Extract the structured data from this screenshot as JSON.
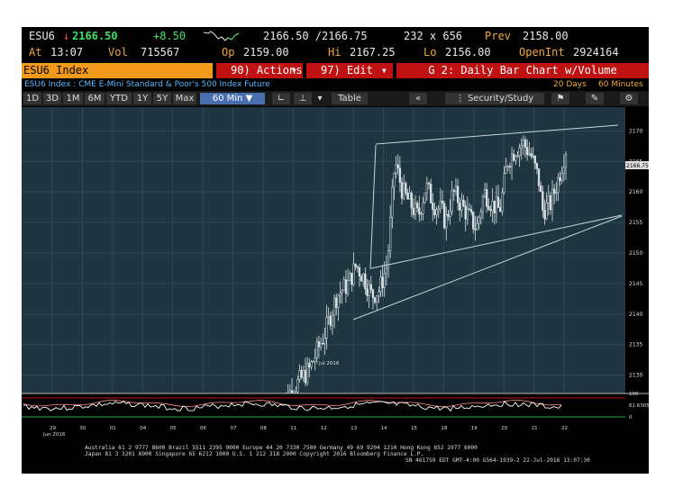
{
  "header": {
    "ticker": "ESU6",
    "last": "2166.50",
    "change": "+8.50",
    "bid_ask": "2166.50 /2166.75",
    "size": "232 x 656",
    "prev_label": "Prev",
    "prev": "2158.00",
    "at_label": "At",
    "time": "13:07",
    "vol_label": "Vol",
    "vol": "715567",
    "op_label": "Op",
    "open": "2159.00",
    "hi_label": "Hi",
    "hi": "2167.25",
    "lo_label": "Lo",
    "lo": "2156.00",
    "oi_label": "OpenInt",
    "oi": "2924164"
  },
  "menubar": {
    "security": "ESU6 Index",
    "actions": "90) Actions",
    "edit": "97) Edit",
    "chart_title": "G 2: Daily Bar Chart w/Volume"
  },
  "desc": {
    "text": "ESU6 Index : CME E-Mini Standard & Poor's 500 Index Future",
    "range": "20 Days",
    "interval": "60 Minutes"
  },
  "toolbar": {
    "periods": [
      "1D",
      "3D",
      "1M",
      "6M",
      "YTD",
      "1Y",
      "5Y",
      "Max"
    ],
    "interval_sel": "60 Min",
    "table": "Table",
    "security_study": "Security/Study"
  },
  "chart_data": {
    "type": "candlestick",
    "y_ticks": [
      "2170",
      "2165",
      "2160",
      "2155",
      "2150",
      "2145",
      "2140",
      "2135",
      "2130"
    ],
    "last_label": "2166.75",
    "x_ticks": [
      "29",
      "30",
      "01",
      "04",
      "05",
      "06",
      "07",
      "08",
      "11",
      "12",
      "13",
      "14",
      "15",
      "18",
      "19",
      "20",
      "21",
      "22"
    ],
    "month_labels": [
      "Jun 2016",
      "Jul 2016"
    ],
    "osc_ticks": [
      "100",
      "61.6305",
      "0"
    ],
    "ylim": [
      2127,
      2173
    ],
    "price_path": [
      [
        0,
        2125
      ],
      [
        8,
        2131
      ],
      [
        10,
        2134
      ],
      [
        12,
        2137
      ],
      [
        15,
        2143
      ],
      [
        18,
        2145
      ],
      [
        20,
        2148
      ],
      [
        22,
        2146
      ],
      [
        24,
        2143
      ],
      [
        26,
        2144
      ],
      [
        28,
        2148
      ],
      [
        30,
        2165
      ],
      [
        32,
        2160
      ],
      [
        34,
        2158
      ],
      [
        36,
        2156
      ],
      [
        38,
        2161
      ],
      [
        40,
        2158
      ],
      [
        42,
        2157
      ],
      [
        43,
        2155
      ],
      [
        45,
        2160
      ],
      [
        47,
        2158
      ],
      [
        49,
        2156
      ],
      [
        51,
        2154
      ],
      [
        53,
        2160
      ],
      [
        55,
        2158
      ],
      [
        57,
        2157
      ],
      [
        59,
        2165
      ],
      [
        61,
        2167
      ],
      [
        63,
        2168
      ],
      [
        65,
        2166
      ],
      [
        67,
        2162
      ],
      [
        68,
        2157
      ],
      [
        70,
        2158
      ],
      [
        72,
        2162
      ],
      [
        74,
        2167
      ]
    ]
  },
  "footer": {
    "line1": "Australia 61 2 9777 8600 Brazil 5511 2395 9000 Europe 44 20 7330 7500 Germany 49 69 9204 1210 Hong Kong 852 2977 6000",
    "line2": "Japan 81 3 3201 8900        Singapore 65 6212 1000       U.S. 1 212 318 2000           Copyright 2016 Bloomberg Finance L.P.",
    "line3": "SN 461759 EDT  GMT-4:00 G564-1939-2 22-Jul-2016 13:07:30"
  }
}
